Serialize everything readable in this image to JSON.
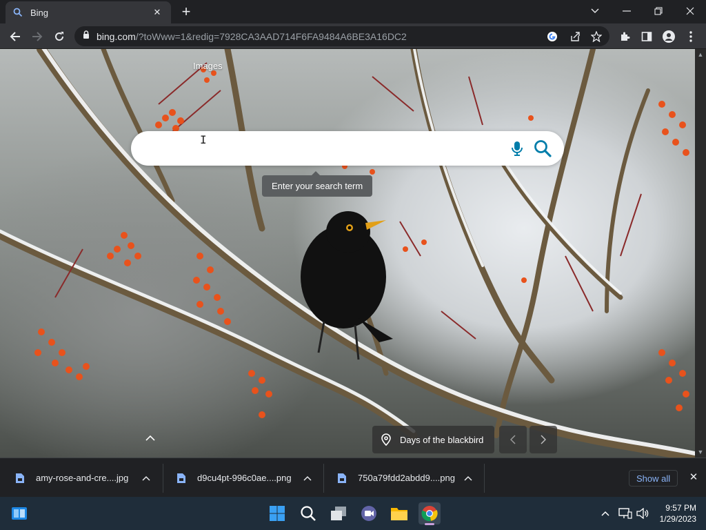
{
  "tab": {
    "title": "Bing",
    "favicon": "bing-search-icon"
  },
  "window_controls": [
    "chevron-down-icon",
    "minimize-icon",
    "restore-icon",
    "close-icon"
  ],
  "toolbar": {
    "url_domain": "bing.com",
    "url_rest": "/?toWww=1&redig=7928CA3AAD714F6FA9484A6BE3A16DC2"
  },
  "page": {
    "images_link": "Images",
    "search_placeholder": "",
    "search_tooltip": "Enter your search term",
    "caption": "Days of the blackbird"
  },
  "downloads": {
    "items": [
      {
        "name": "amy-rose-and-cre....jpg"
      },
      {
        "name": "d9cu4pt-996c0ae....png"
      },
      {
        "name": "750a79fdd2abdd9....png"
      }
    ],
    "show_all": "Show all"
  },
  "taskbar": {
    "apps": [
      "windows-start-icon",
      "search-icon",
      "task-view-icon",
      "teams-chat-icon",
      "file-explorer-icon",
      "chrome-icon"
    ],
    "time": "9:57 PM",
    "date": "1/29/2023"
  },
  "colors": {
    "accent_bing": "#007daa",
    "link_blue": "#8ab4f8",
    "chrome_dark": "#202124",
    "toolbar": "#35363a"
  }
}
